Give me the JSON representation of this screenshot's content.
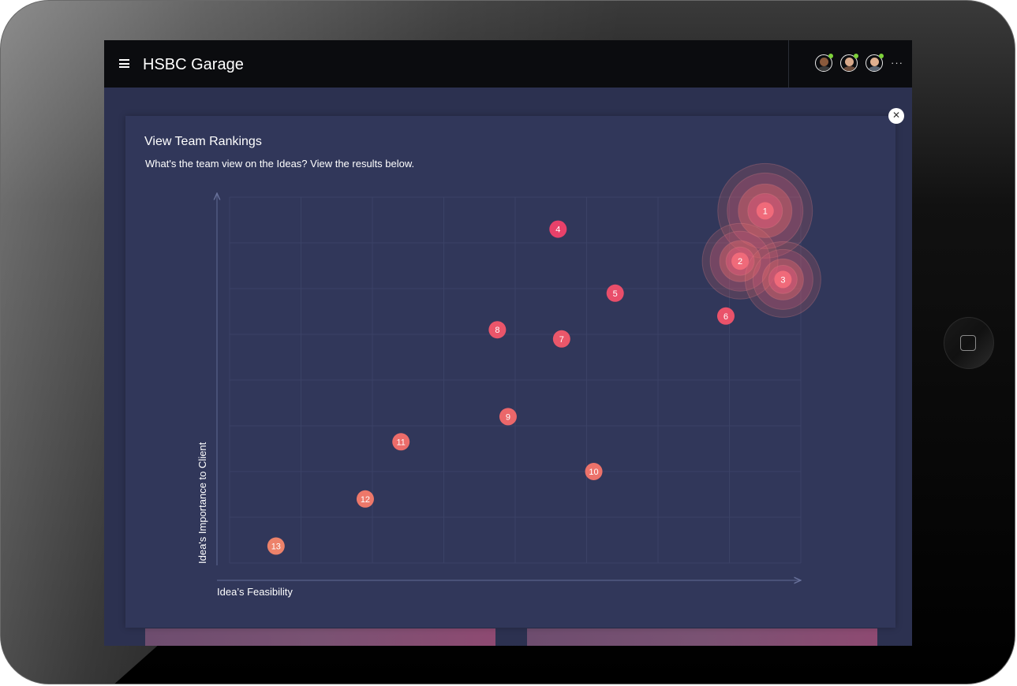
{
  "app": {
    "title": "HSBC Garage"
  },
  "header": {
    "menu_icon": "hamburger-menu-icon",
    "avatars": [
      {
        "name": "user-avatar",
        "skin": "#8a5a3c",
        "shirt": "#3a3a3a"
      },
      {
        "name": "user-avatar",
        "skin": "#d9a98a",
        "shirt": "#6b4b3a"
      },
      {
        "name": "user-avatar",
        "skin": "#e0b08f",
        "shirt": "#5a6470"
      }
    ],
    "more_icon": "more-horizontal-icon",
    "more_glyph": "···"
  },
  "panel": {
    "close_glyph": "✕",
    "title": "View Team Rankings",
    "subtitle": "What's the team view on the Ideas? View the results below."
  },
  "chart_data": {
    "type": "scatter",
    "xlabel": "Idea’s Feasibility",
    "ylabel": "Idea's Importance to Client",
    "xlim": [
      0,
      8
    ],
    "ylim": [
      0,
      8
    ],
    "grid": true,
    "points": [
      {
        "label": "1",
        "x": 7.5,
        "y": 7.7,
        "highlight": true
      },
      {
        "label": "2",
        "x": 7.15,
        "y": 6.6,
        "highlight": true
      },
      {
        "label": "3",
        "x": 7.75,
        "y": 6.2,
        "highlight": true
      },
      {
        "label": "4",
        "x": 4.6,
        "y": 7.3
      },
      {
        "label": "5",
        "x": 5.4,
        "y": 5.9
      },
      {
        "label": "6",
        "x": 6.95,
        "y": 5.4
      },
      {
        "label": "7",
        "x": 4.65,
        "y": 4.9
      },
      {
        "label": "8",
        "x": 3.75,
        "y": 5.1
      },
      {
        "label": "9",
        "x": 3.9,
        "y": 3.2
      },
      {
        "label": "10",
        "x": 5.1,
        "y": 2.0
      },
      {
        "label": "11",
        "x": 2.4,
        "y": 2.65
      },
      {
        "label": "12",
        "x": 1.9,
        "y": 1.4
      },
      {
        "label": "13",
        "x": 0.65,
        "y": 0.37
      }
    ],
    "colors": {
      "hot": "#e83a6a",
      "warm": "#e0556a",
      "cool": "#ee8a6a",
      "axis": "#58618a",
      "grid": "#3b4266"
    }
  }
}
